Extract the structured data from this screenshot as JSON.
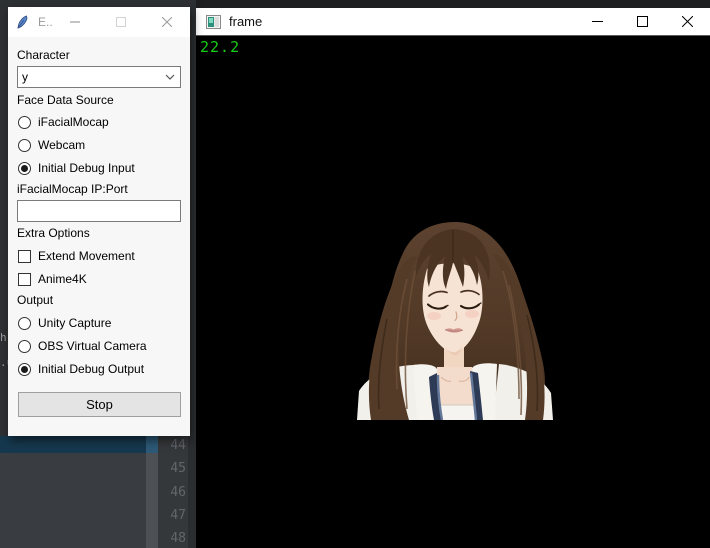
{
  "dialog": {
    "title": "E...",
    "character": {
      "label": "Character",
      "value": "y"
    },
    "face_source": {
      "label": "Face Data Source",
      "items": [
        {
          "label": "iFacialMocap",
          "selected": false
        },
        {
          "label": "Webcam",
          "selected": false
        },
        {
          "label": "Initial Debug Input",
          "selected": true
        }
      ]
    },
    "ip_port": {
      "label": "iFacialMocap IP:Port",
      "value": ""
    },
    "extra": {
      "label": "Extra Options",
      "items": [
        {
          "label": "Extend Movement",
          "checked": false
        },
        {
          "label": "Anime4K",
          "checked": false
        }
      ]
    },
    "output": {
      "label": "Output",
      "items": [
        {
          "label": "Unity Capture",
          "selected": false
        },
        {
          "label": "OBS Virtual Camera",
          "selected": false
        },
        {
          "label": "Initial Debug Output",
          "selected": true
        }
      ]
    },
    "stop_label": "Stop"
  },
  "frame_window": {
    "title": "frame",
    "fps": "22.2",
    "fps_color": "#17cf17"
  },
  "editor": {
    "line_numbers": [
      "44",
      "45",
      "46",
      "47",
      "48"
    ],
    "fragment_a": "h",
    "fragment_b": ".u",
    "selection_color": "#16384e"
  }
}
